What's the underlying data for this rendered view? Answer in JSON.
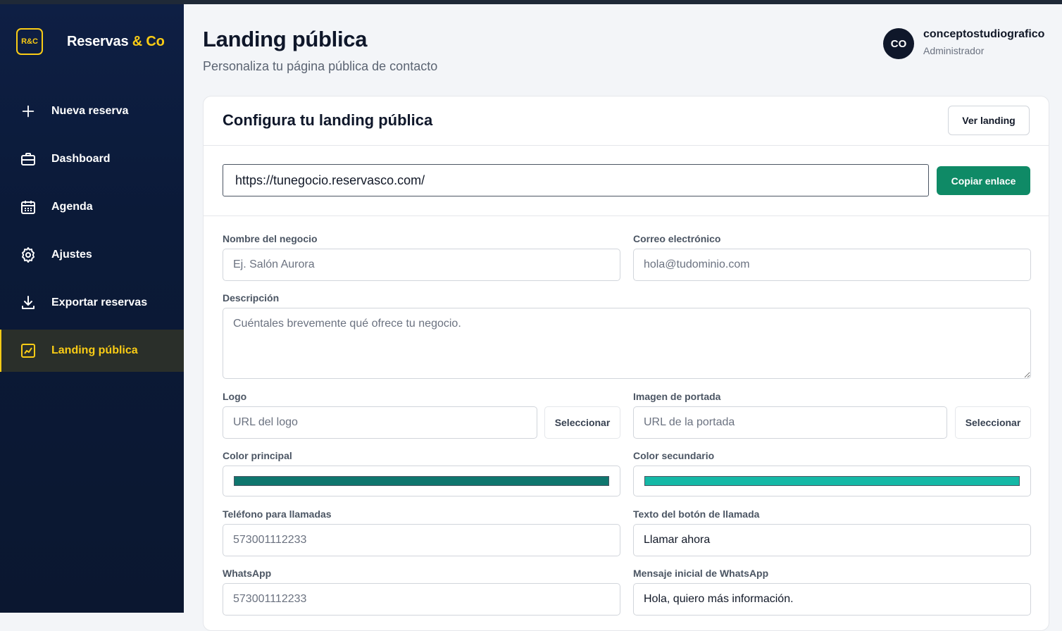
{
  "brand": {
    "badge": "R&C",
    "name": "Reservas ",
    "accent": "& Co",
    "accent_color": "#facc15"
  },
  "nav": [
    {
      "label": "Nueva reserva",
      "icon": "plus-icon",
      "active": false
    },
    {
      "label": "Dashboard",
      "icon": "briefcase-icon",
      "active": false
    },
    {
      "label": "Agenda",
      "icon": "calendar-icon",
      "active": false
    },
    {
      "label": "Ajustes",
      "icon": "gear-icon",
      "active": false
    },
    {
      "label": "Exportar reservas",
      "icon": "download-icon",
      "active": false
    },
    {
      "label": "Landing pública",
      "icon": "chart-icon",
      "active": true
    }
  ],
  "page": {
    "title": "Landing pública",
    "subtitle": "Personaliza tu página pública de contacto"
  },
  "user": {
    "initials": "CO",
    "name": "conceptostudiografico",
    "role": "Administrador"
  },
  "card": {
    "title": "Configura tu landing pública",
    "view_button": "Ver landing",
    "public_url": "https://tunegocio.reservasco.com/",
    "copy_button": "Copiar enlace",
    "copy_button_color": "#0f8a66"
  },
  "form": {
    "business_name": {
      "label": "Nombre del negocio",
      "placeholder": "Ej. Salón Aurora",
      "value": ""
    },
    "email": {
      "label": "Correo electrónico",
      "placeholder": "hola@tudominio.com",
      "value": ""
    },
    "description": {
      "label": "Descripción",
      "placeholder": "Cuéntales brevemente qué ofrece tu negocio.",
      "value": ""
    },
    "logo": {
      "label": "Logo",
      "placeholder": "URL del logo",
      "button": "Seleccionar"
    },
    "cover": {
      "label": "Imagen de portada",
      "placeholder": "URL de la portada",
      "button": "Seleccionar"
    },
    "primary_color": {
      "label": "Color principal",
      "value": "#0f766e"
    },
    "secondary_color": {
      "label": "Color secundario",
      "value": "#14b8a6"
    },
    "phone": {
      "label": "Teléfono para llamadas",
      "placeholder": "573001112233",
      "value": ""
    },
    "call_text": {
      "label": "Texto del botón de llamada",
      "value": "Llamar ahora"
    },
    "whatsapp": {
      "label": "WhatsApp",
      "placeholder": "573001112233",
      "value": ""
    },
    "whatsapp_message": {
      "label": "Mensaje inicial de WhatsApp",
      "value": "Hola, quiero más información."
    }
  }
}
